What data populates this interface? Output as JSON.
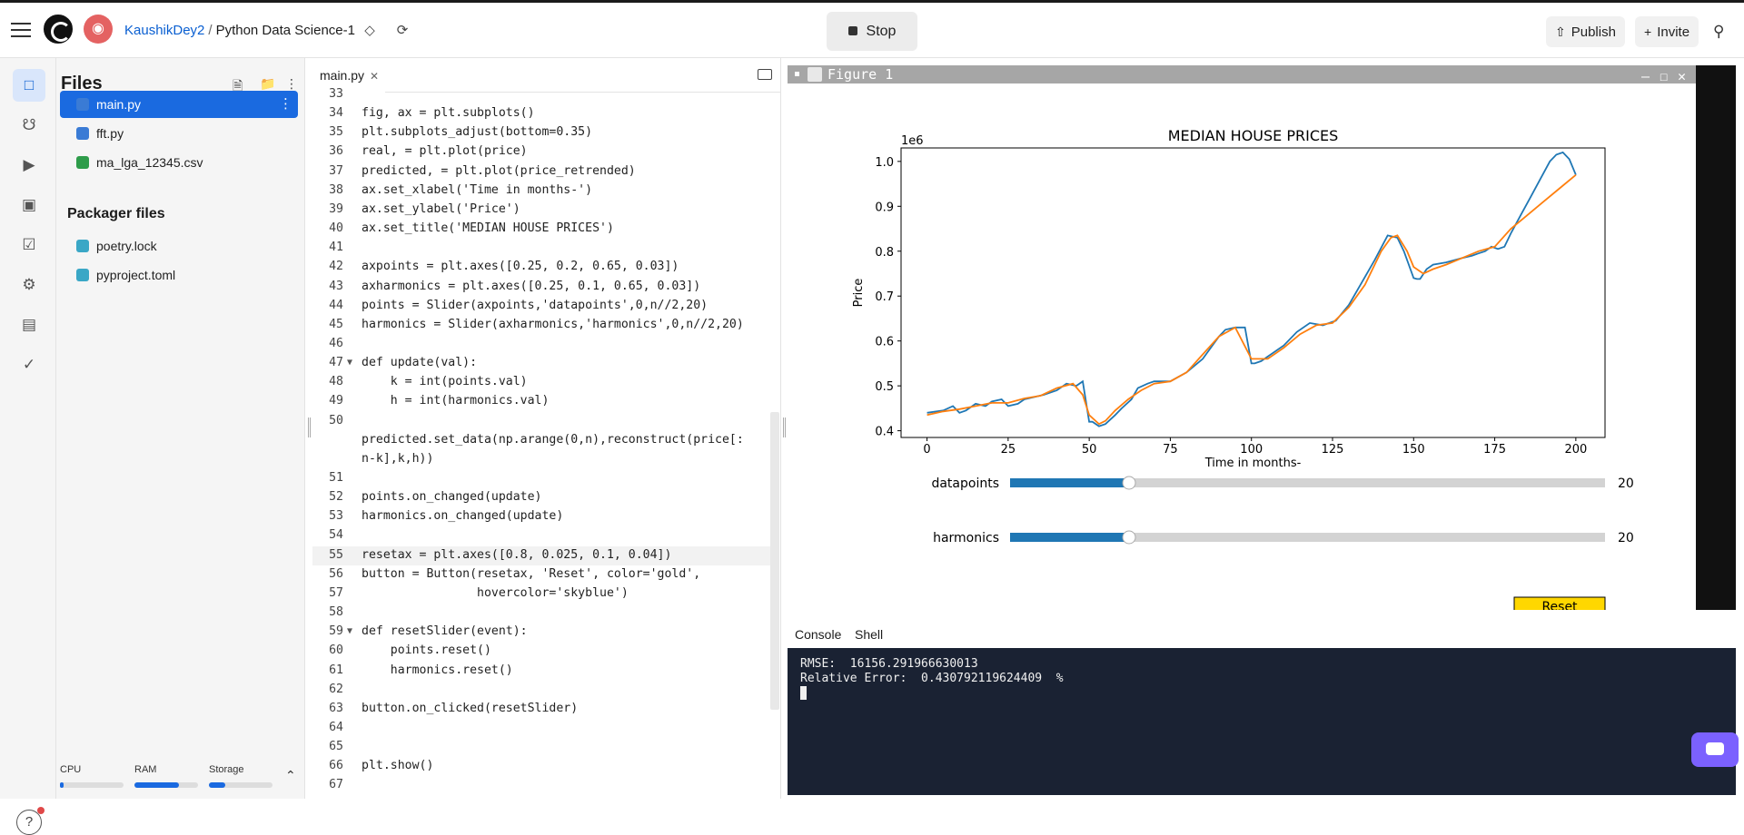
{
  "header": {
    "username": "KaushikDey2",
    "separator": "/",
    "project": "Python Data Science-1",
    "stop_label": "Stop",
    "publish_label": "Publish",
    "invite_label": "Invite"
  },
  "files_panel": {
    "title": "Files",
    "files": [
      {
        "name": "main.py",
        "icon": "python-icon",
        "selected": true
      },
      {
        "name": "fft.py",
        "icon": "python-icon",
        "selected": false
      },
      {
        "name": "ma_lga_12345.csv",
        "icon": "csv-icon",
        "selected": false
      }
    ],
    "packager_title": "Packager files",
    "packager_files": [
      {
        "name": "poetry.lock",
        "icon": "python-icon"
      },
      {
        "name": "pyproject.toml",
        "icon": "python-icon"
      }
    ],
    "resources": {
      "cpu_label": "CPU",
      "ram_label": "RAM",
      "storage_label": "Storage",
      "cpu": 0.05,
      "ram": 0.7,
      "storage": 0.25
    }
  },
  "editor": {
    "tab_label": "main.py",
    "lines": [
      {
        "n": "33",
        "code": ""
      },
      {
        "n": "34",
        "code": "fig, ax = plt.subplots()"
      },
      {
        "n": "35",
        "code": "plt.subplots_adjust(bottom=0.35)"
      },
      {
        "n": "36",
        "code": "real, = plt.plot(price)"
      },
      {
        "n": "37",
        "code": "predicted, = plt.plot(price_retrended)"
      },
      {
        "n": "38",
        "code": "ax.set_xlabel('Time in months-')"
      },
      {
        "n": "39",
        "code": "ax.set_ylabel('Price')"
      },
      {
        "n": "40",
        "code": "ax.set_title('MEDIAN HOUSE PRICES')"
      },
      {
        "n": "41",
        "code": ""
      },
      {
        "n": "42",
        "code": "axpoints = plt.axes([0.25, 0.2, 0.65, 0.03])"
      },
      {
        "n": "43",
        "code": "axharmonics = plt.axes([0.25, 0.1, 0.65, 0.03])"
      },
      {
        "n": "44",
        "code": "points = Slider(axpoints,'datapoints',0,n//2,20)"
      },
      {
        "n": "45",
        "code": "harmonics = Slider(axharmonics,'harmonics',0,n//2,20)"
      },
      {
        "n": "46",
        "code": ""
      },
      {
        "n": "47",
        "code": "def update(val):",
        "fold": true
      },
      {
        "n": "48",
        "code": "    k = int(points.val)"
      },
      {
        "n": "49",
        "code": "    h = int(harmonics.val)"
      },
      {
        "n": "50",
        "code": ""
      },
      {
        "n": "",
        "code": "predicted.set_data(np.arange(0,n),reconstruct(price[:"
      },
      {
        "n": "",
        "code": "n-k],k,h))"
      },
      {
        "n": "51",
        "code": ""
      },
      {
        "n": "52",
        "code": "points.on_changed(update)"
      },
      {
        "n": "53",
        "code": "harmonics.on_changed(update)"
      },
      {
        "n": "54",
        "code": ""
      },
      {
        "n": "55",
        "code": "resetax = plt.axes([0.8, 0.025, 0.1, 0.04])",
        "current": true
      },
      {
        "n": "56",
        "code": "button = Button(resetax, 'Reset', color='gold',"
      },
      {
        "n": "57",
        "code": "                hovercolor='skyblue')"
      },
      {
        "n": "58",
        "code": ""
      },
      {
        "n": "59",
        "code": "def resetSlider(event):",
        "fold": true
      },
      {
        "n": "60",
        "code": "    points.reset()"
      },
      {
        "n": "61",
        "code": "    harmonics.reset()"
      },
      {
        "n": "62",
        "code": ""
      },
      {
        "n": "63",
        "code": "button.on_clicked(resetSlider)"
      },
      {
        "n": "64",
        "code": ""
      },
      {
        "n": "65",
        "code": ""
      },
      {
        "n": "66",
        "code": "plt.show()"
      },
      {
        "n": "67",
        "code": ""
      }
    ]
  },
  "figure": {
    "window_title": "Figure 1",
    "sliders": [
      {
        "label": "datapoints",
        "value": "20",
        "fraction": 0.2
      },
      {
        "label": "harmonics",
        "value": "20",
        "fraction": 0.2
      }
    ],
    "reset_label": "Reset",
    "reset_color": "#ffd700"
  },
  "chart_data": {
    "type": "line",
    "title": "MEDIAN HOUSE PRICES",
    "xlabel": "Time in months-",
    "ylabel": "Price",
    "y_offset_label": "1e6",
    "xlim": [
      -8,
      209
    ],
    "ylim": [
      0.385,
      1.03
    ],
    "xticks": [
      0,
      25,
      50,
      75,
      100,
      125,
      150,
      175,
      200
    ],
    "xtick_labels": [
      "0",
      "25",
      "50",
      "75",
      "100",
      "125",
      "150",
      "175",
      "200"
    ],
    "yticks": [
      0.4,
      0.5,
      0.6,
      0.7,
      0.8,
      0.9,
      1.0
    ],
    "ytick_labels": [
      "0.4",
      "0.5",
      "0.6",
      "0.7",
      "0.8",
      "0.9",
      "1.0"
    ],
    "series": [
      {
        "color": "#1f77b4",
        "x": [
          0,
          5,
          8,
          10,
          12,
          15,
          18,
          20,
          23,
          25,
          28,
          30,
          33,
          36,
          40,
          43,
          46,
          48,
          50,
          51,
          53,
          55,
          58,
          60,
          63,
          65,
          68,
          70,
          75,
          80,
          85,
          90,
          92,
          95,
          98,
          100,
          101,
          103,
          106,
          110,
          114,
          118,
          122,
          126,
          130,
          134,
          138,
          142,
          145,
          147,
          150,
          151,
          152,
          154,
          156,
          160,
          165,
          168,
          170,
          172,
          174,
          176,
          178,
          180,
          183,
          186,
          189,
          192,
          194,
          196,
          198,
          200
        ],
        "y": [
          0.44,
          0.445,
          0.455,
          0.44,
          0.445,
          0.46,
          0.455,
          0.465,
          0.47,
          0.455,
          0.46,
          0.47,
          0.475,
          0.48,
          0.49,
          0.505,
          0.5,
          0.51,
          0.42,
          0.42,
          0.41,
          0.415,
          0.435,
          0.45,
          0.47,
          0.495,
          0.505,
          0.51,
          0.51,
          0.53,
          0.56,
          0.61,
          0.625,
          0.63,
          0.63,
          0.55,
          0.55,
          0.555,
          0.57,
          0.59,
          0.62,
          0.64,
          0.635,
          0.645,
          0.68,
          0.73,
          0.78,
          0.835,
          0.83,
          0.8,
          0.74,
          0.738,
          0.738,
          0.76,
          0.77,
          0.775,
          0.785,
          0.79,
          0.795,
          0.8,
          0.81,
          0.805,
          0.81,
          0.84,
          0.88,
          0.92,
          0.96,
          1.0,
          1.015,
          1.02,
          1.005,
          0.97
        ]
      },
      {
        "color": "#ff7f0e",
        "x": [
          0,
          5,
          10,
          15,
          20,
          25,
          30,
          35,
          40,
          45,
          48,
          50,
          53,
          55,
          58,
          62,
          66,
          70,
          75,
          80,
          85,
          90,
          95,
          100,
          105,
          110,
          115,
          120,
          125,
          130,
          135,
          140,
          143,
          145,
          148,
          150,
          153,
          156,
          160,
          165,
          170,
          175,
          180,
          185,
          190,
          195,
          200
        ],
        "y": [
          0.435,
          0.443,
          0.448,
          0.455,
          0.462,
          0.462,
          0.472,
          0.478,
          0.495,
          0.505,
          0.48,
          0.435,
          0.415,
          0.422,
          0.445,
          0.47,
          0.49,
          0.505,
          0.51,
          0.53,
          0.57,
          0.61,
          0.63,
          0.56,
          0.56,
          0.585,
          0.615,
          0.635,
          0.64,
          0.675,
          0.725,
          0.8,
          0.83,
          0.835,
          0.8,
          0.765,
          0.75,
          0.76,
          0.77,
          0.785,
          0.8,
          0.81,
          0.85,
          0.88,
          0.91,
          0.94,
          0.97
        ]
      }
    ]
  },
  "console": {
    "tabs": [
      "Console",
      "Shell"
    ],
    "lines": [
      "RMSE:  16156.291966630013",
      "Relative Error:  0.430792119624409  %"
    ]
  }
}
